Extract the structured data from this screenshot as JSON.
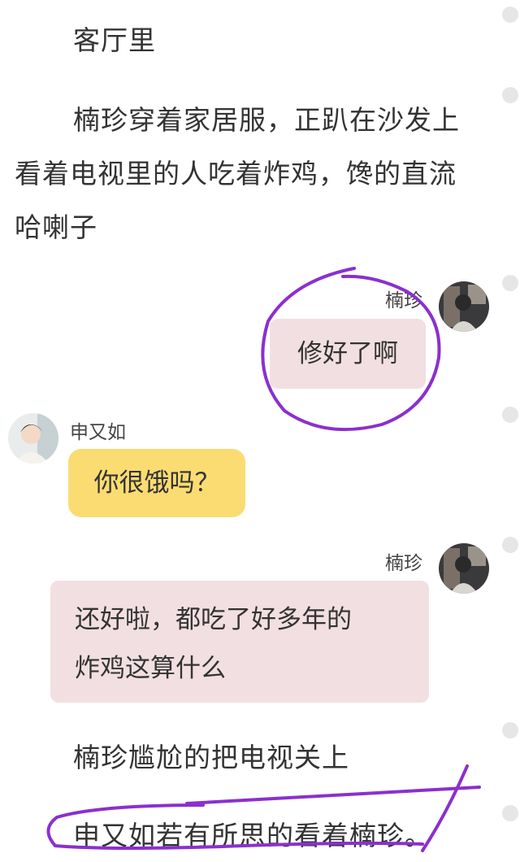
{
  "narration": {
    "line1": "客厅里",
    "para1_l1": "楠珍穿着家居服，正趴在沙发上",
    "para1_l2": "看着电视里的人吃着炸鸡，馋的直流",
    "para1_l3": "哈喇子",
    "line4": "楠珍尴尬的把电视关上",
    "line5": "申又如若有所思的看着楠珍。"
  },
  "messages": [
    {
      "sender": "楠珍",
      "text": "修好了啊"
    },
    {
      "sender": "申又如",
      "text": "你很饿吗？"
    },
    {
      "sender": "楠珍",
      "text_l1": "还好啦，都吃了好多年的",
      "text_l2": "炸鸡这算什么"
    }
  ],
  "colors": {
    "pink_bubble": "#f2dfe1",
    "yellow_bubble": "#fbdc72",
    "annotation_ink": "#8b2fd0"
  },
  "icons": {
    "nanzhen_avatar": "avatar-nanzhen",
    "shenyouru_avatar": "avatar-shenyouru"
  }
}
